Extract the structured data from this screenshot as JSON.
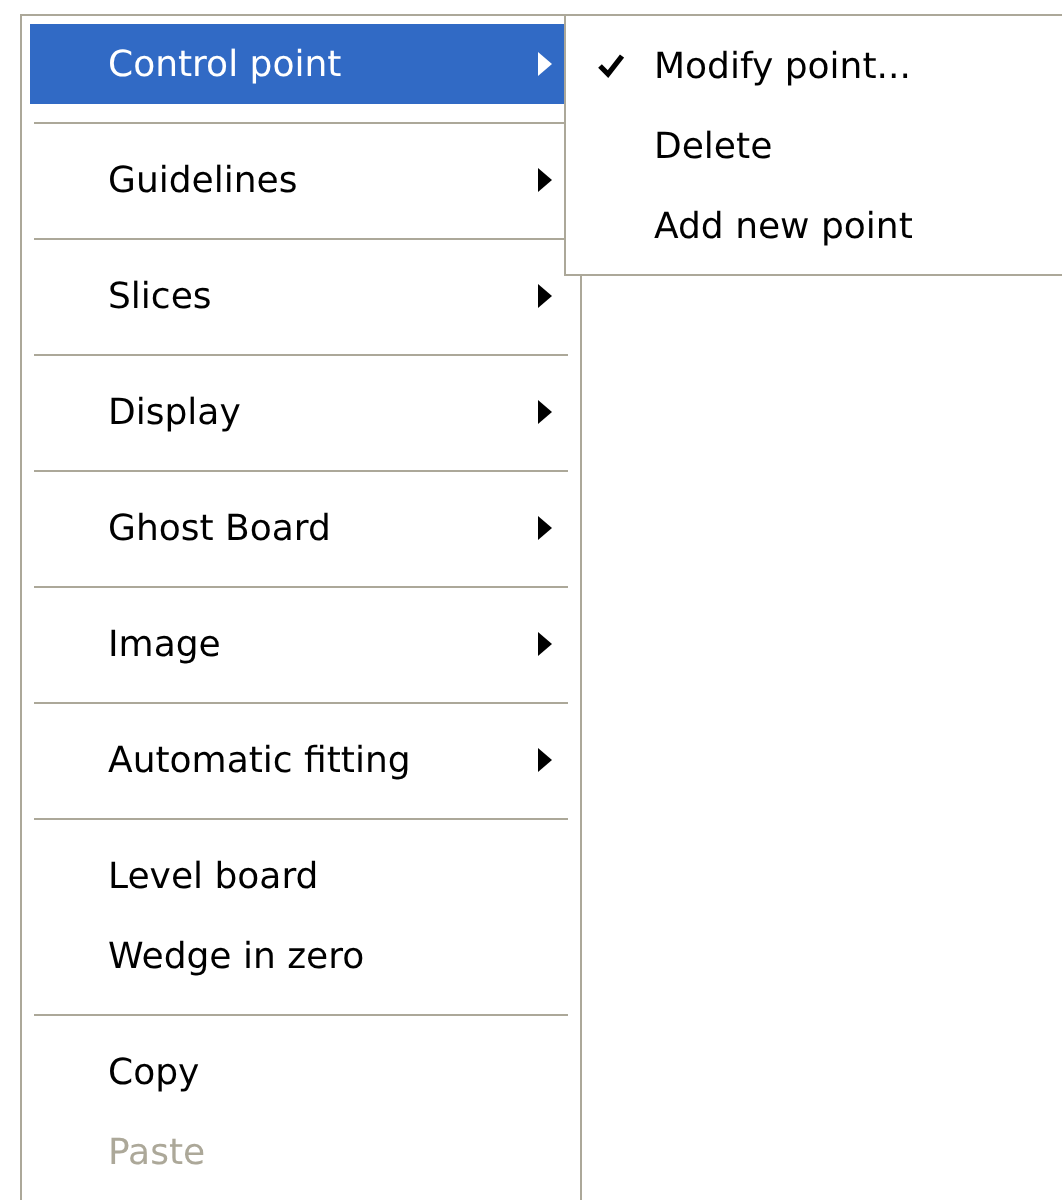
{
  "menu": {
    "items": [
      {
        "kind": "item",
        "label": "Control point",
        "submenu": true,
        "selected": true,
        "disabled": false
      },
      {
        "kind": "separator"
      },
      {
        "kind": "item",
        "label": "Guidelines",
        "submenu": true,
        "selected": false,
        "disabled": false
      },
      {
        "kind": "separator"
      },
      {
        "kind": "item",
        "label": "Slices",
        "submenu": true,
        "selected": false,
        "disabled": false
      },
      {
        "kind": "separator"
      },
      {
        "kind": "item",
        "label": "Display",
        "submenu": true,
        "selected": false,
        "disabled": false
      },
      {
        "kind": "separator"
      },
      {
        "kind": "item",
        "label": "Ghost Board",
        "submenu": true,
        "selected": false,
        "disabled": false
      },
      {
        "kind": "separator"
      },
      {
        "kind": "item",
        "label": "Image",
        "submenu": true,
        "selected": false,
        "disabled": false
      },
      {
        "kind": "separator"
      },
      {
        "kind": "item",
        "label": "Automatic fitting",
        "submenu": true,
        "selected": false,
        "disabled": false
      },
      {
        "kind": "separator"
      },
      {
        "kind": "item",
        "label": "Level board",
        "submenu": false,
        "selected": false,
        "disabled": false
      },
      {
        "kind": "item",
        "label": "Wedge in zero",
        "submenu": false,
        "selected": false,
        "disabled": false
      },
      {
        "kind": "separator"
      },
      {
        "kind": "item",
        "label": "Copy",
        "submenu": false,
        "selected": false,
        "disabled": false
      },
      {
        "kind": "item",
        "label": "Paste",
        "submenu": false,
        "selected": false,
        "disabled": true
      }
    ]
  },
  "submenu": {
    "items": [
      {
        "label": "Modify point...",
        "checked": true
      },
      {
        "label": "Delete",
        "checked": false
      },
      {
        "label": "Add new point",
        "checked": false
      }
    ]
  }
}
